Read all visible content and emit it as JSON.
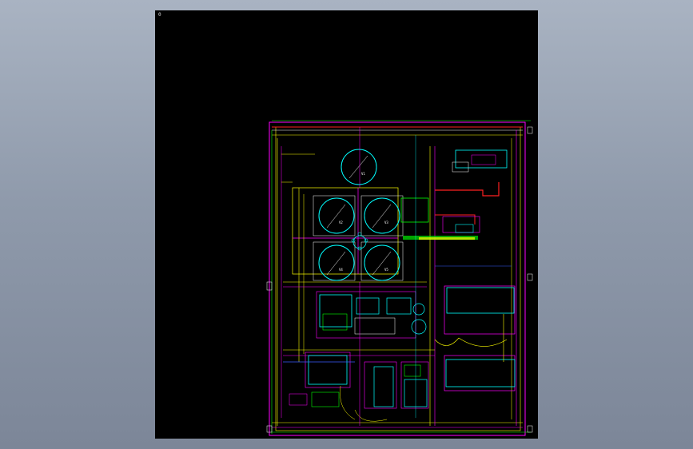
{
  "viewer": {
    "background": "#000000",
    "corner_label": "0"
  },
  "colors": {
    "frame_magenta": "#ff00ff",
    "cyan": "#00ffff",
    "yellow": "#ffff00",
    "green": "#00ff00",
    "red": "#ff2020",
    "white": "#ffffff",
    "blue": "#3a5cff"
  },
  "drawing": {
    "type": "site-plan",
    "tanks": [
      {
        "label": "V1"
      },
      {
        "label": "V2"
      },
      {
        "label": "V3"
      },
      {
        "label": "V4"
      },
      {
        "label": "V5"
      }
    ]
  }
}
